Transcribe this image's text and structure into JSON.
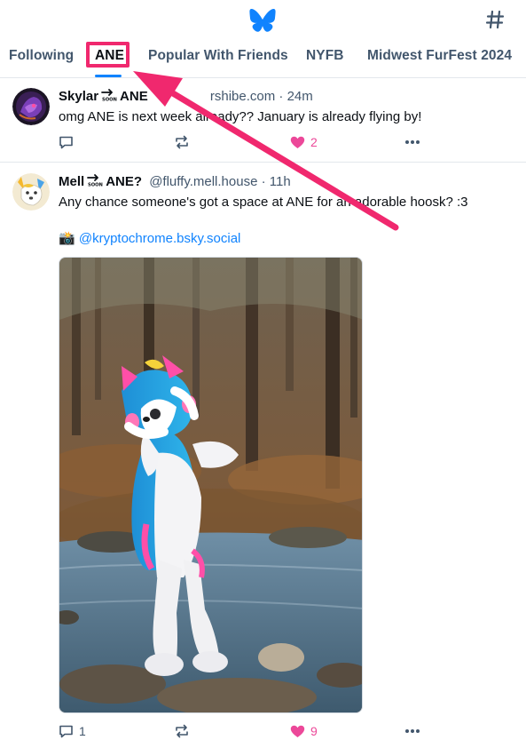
{
  "tabs": [
    {
      "label": "Following"
    },
    {
      "label": "ANE"
    },
    {
      "label": "Popular With Friends"
    },
    {
      "label": "NYFB"
    },
    {
      "label": "Midwest FurFest 2024"
    }
  ],
  "icons": {
    "logo": "butterfly-icon",
    "hash": "hash-icon",
    "reply": "reply-icon",
    "repost": "repost-icon",
    "like": "heart-icon",
    "more": "more-icon",
    "soon": "soon-arrow-icon",
    "camera": "camera-icon"
  },
  "colors": {
    "brand": "#1083fe",
    "like": "#ec4899",
    "highlight": "#f0286e",
    "muted": "#42566c"
  },
  "posts": [
    {
      "name_pre": "Skylar",
      "name_post": "ANE",
      "handle": "rshibe.com · 24m",
      "text": "omg ANE is next week already?? January is already flying by!",
      "replies": "",
      "reposts": "",
      "likes": "2"
    },
    {
      "name_pre": "Mell",
      "name_post": "ANE?",
      "handle": "@fluffy.mell.house · 11h",
      "text": "Any chance someone's got a space at ANE for an adorable hoosk? :3",
      "camera": "📸",
      "mention": "@kryptochrome.bsky.social",
      "replies": "1",
      "reposts": "",
      "likes": "9"
    }
  ]
}
